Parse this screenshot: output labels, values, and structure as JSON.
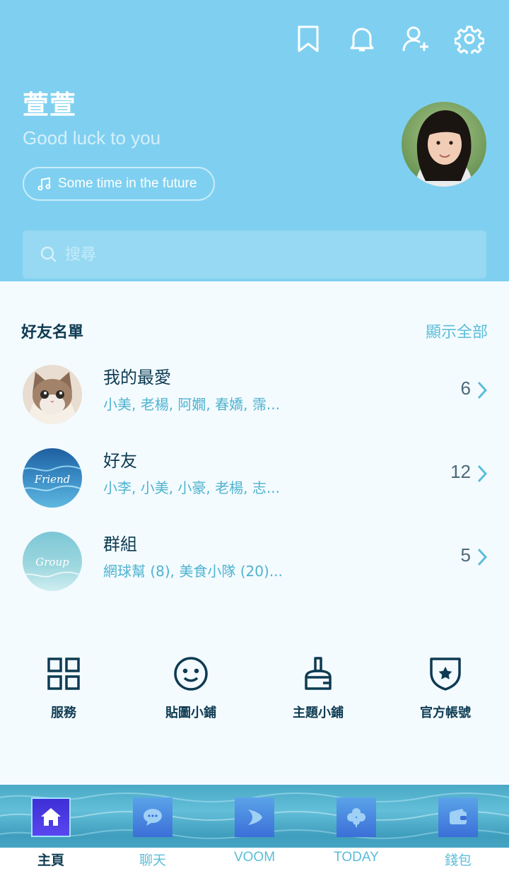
{
  "header": {
    "profile_name": "萱萱",
    "status_message": "Good luck to you",
    "music": "Some time in the future",
    "icons": [
      "bookmark-icon",
      "bell-icon",
      "add-friend-icon",
      "gear-icon"
    ]
  },
  "search": {
    "placeholder": "搜尋"
  },
  "friends": {
    "title": "好友名單",
    "show_all": "顯示全部",
    "rows": [
      {
        "title": "我的最愛",
        "subtitle": "小美, 老楊, 阿嫺, 春嬌, 霈...",
        "count": "6"
      },
      {
        "title": "好友",
        "subtitle": "小李, 小美, 小豪, 老楊, 志...",
        "count": "12"
      },
      {
        "title": "群組",
        "subtitle": "網球幫 (8), 美食小隊 (20)...",
        "count": "5"
      }
    ],
    "thumb_text": [
      "Friend",
      "Group"
    ]
  },
  "services": [
    {
      "label": "服務",
      "icon": "grid-icon"
    },
    {
      "label": "貼圖小鋪",
      "icon": "smiley-icon"
    },
    {
      "label": "主題小鋪",
      "icon": "brush-icon"
    },
    {
      "label": "官方帳號",
      "icon": "shield-star-icon"
    }
  ],
  "bottom_nav": [
    {
      "label": "主頁",
      "icon": "home-icon",
      "active": true
    },
    {
      "label": "聊天",
      "icon": "chat-icon",
      "active": false
    },
    {
      "label": "VOOM",
      "icon": "voom-icon",
      "active": false
    },
    {
      "label": "TODAY",
      "icon": "clover-icon",
      "active": false
    },
    {
      "label": "錢包",
      "icon": "wallet-icon",
      "active": false
    }
  ],
  "colors": {
    "header_bg": "#7fd0f0",
    "accent": "#5bbdd8",
    "text_dark": "#0d3b52",
    "active_nav": "#3d2fd6"
  }
}
